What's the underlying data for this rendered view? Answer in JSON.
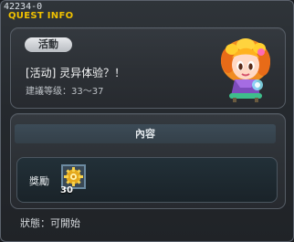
{
  "window": {
    "quest_id": "42234-0",
    "title": "QUEST INFO"
  },
  "quest": {
    "tag": "活動",
    "name": "[活动] 灵异体验？！",
    "recommended_level": "建議等级：33～37",
    "avatar_icon": "quest-giver-girl"
  },
  "content": {
    "header": "內容",
    "reward_label": "獎勵",
    "reward_item": {
      "icon": "gold-gear-item-icon",
      "quantity": "30"
    }
  },
  "status": {
    "text": "狀態：可開始"
  },
  "colors": {
    "title_accent": "#f0c100",
    "panel": "#2c3035",
    "header": "#3c4b57",
    "reward_border": "#6c8ba2"
  }
}
